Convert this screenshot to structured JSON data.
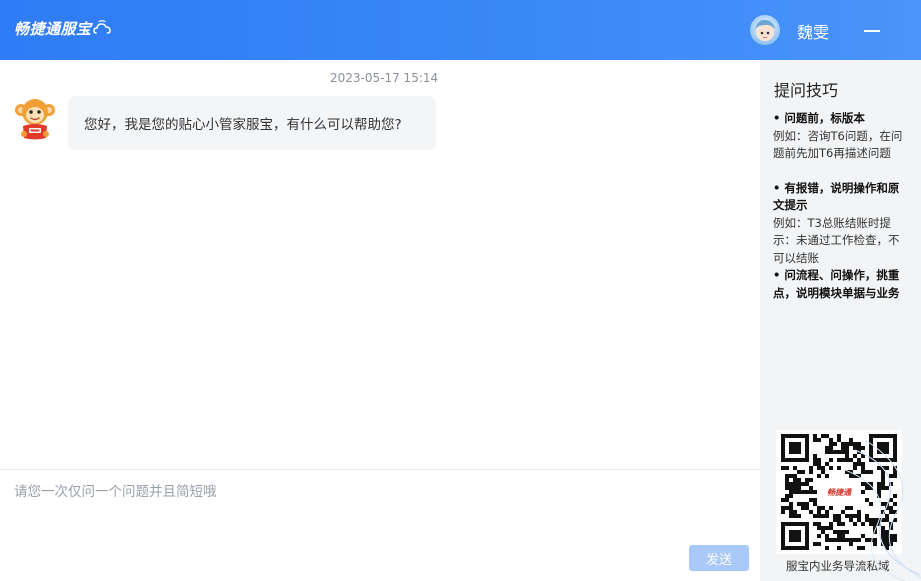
{
  "header": {
    "logo_text": "畅捷通服宝",
    "username": "魏雯",
    "minimize_icon": "minus-icon"
  },
  "chat": {
    "timestamp": "2023-05-17 15:14",
    "bot_message": "您好，我是您的贴心小管家服宝，有什么可以帮助您?"
  },
  "input": {
    "placeholder": "请您一次仅问一个问题并且简短哦",
    "value": "",
    "send_label": "发送"
  },
  "sidebar": {
    "title": "提问技巧",
    "tips": [
      {
        "head": "• 问题前，标版本",
        "body": "例如：咨询T6问题，在问题前先加T6再描述问题"
      },
      {
        "head": "• 有报错，说明操作和原文提示",
        "body": "例如：T3总账结账时提示：未通过工作检查，不可以结账"
      },
      {
        "head": "• 问流程、问操作，挑重点，说明模块单据与业务",
        "body": ""
      }
    ],
    "qr_logo": "畅捷通",
    "qr_caption": "服宝内业务导流私域"
  },
  "colors": {
    "header_start": "#2f7cf6",
    "header_end": "#4a94fa",
    "bubble_bg": "#f4f5f7",
    "send_button": "#a9c9fb",
    "sidebar_bg": "#f3f4f6"
  }
}
